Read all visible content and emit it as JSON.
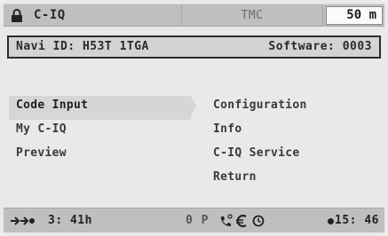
{
  "topbar": {
    "title": "C-IQ",
    "tmc": "TMC",
    "scale": "50 m"
  },
  "infobar": {
    "navi_id": "Navi ID: H53T 1TGA",
    "software": "Software: 0003"
  },
  "menu_left": [
    {
      "label": "Code Input",
      "selected": true
    },
    {
      "label": "My C-IQ"
    },
    {
      "label": "Preview"
    }
  ],
  "menu_right": [
    {
      "label": "Configuration"
    },
    {
      "label": "Info"
    },
    {
      "label": "C-IQ Service"
    },
    {
      "label": "Return"
    }
  ],
  "bottombar": {
    "remaining": "3: 41h",
    "status": "0 P",
    "clock": "15: 46"
  }
}
